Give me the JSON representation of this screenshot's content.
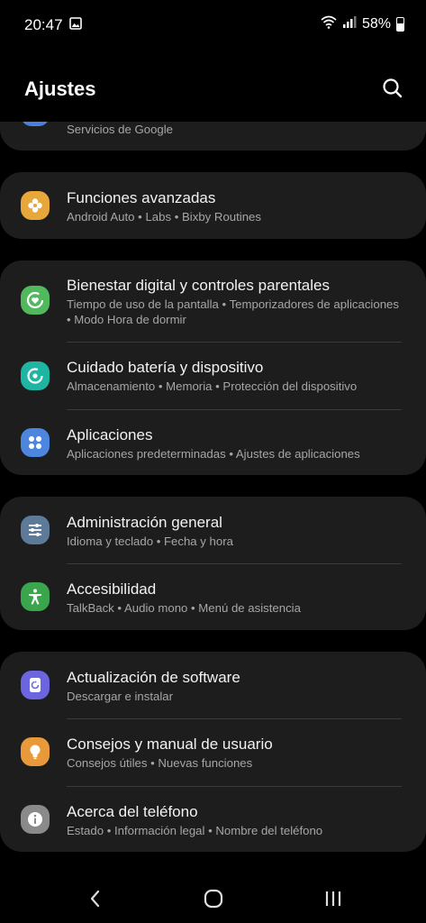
{
  "status": {
    "time": "20:47",
    "battery": "58%"
  },
  "header": {
    "title": "Ajustes"
  },
  "groups": [
    {
      "items": [
        {
          "title": "",
          "subtitle": "Servicios de Google",
          "icon": "google-icon",
          "color": "#4a7fe0"
        }
      ]
    },
    {
      "items": [
        {
          "title": "Funciones avanzadas",
          "subtitle": "Android Auto  •  Labs  •  Bixby Routines",
          "icon": "puzzle-icon",
          "color": "#e7a73a"
        }
      ]
    },
    {
      "items": [
        {
          "title": "Bienestar digital y controles parentales",
          "subtitle": "Tiempo de uso de la pantalla  •  Temporizadores de aplicaciones  •  Modo Hora de dormir",
          "icon": "wellbeing-icon",
          "color": "#52b85e"
        },
        {
          "title": "Cuidado batería y dispositivo",
          "subtitle": "Almacenamiento  •  Memoria  •  Protección del dispositivo",
          "icon": "device-care-icon",
          "color": "#1fb5a3"
        },
        {
          "title": "Aplicaciones",
          "subtitle": "Aplicaciones predeterminadas  •  Ajustes de aplicaciones",
          "icon": "apps-icon",
          "color": "#4d86de"
        }
      ]
    },
    {
      "items": [
        {
          "title": "Administración general",
          "subtitle": "Idioma y teclado  •  Fecha y hora",
          "icon": "sliders-icon",
          "color": "#5d7a99"
        },
        {
          "title": "Accesibilidad",
          "subtitle": "TalkBack  •  Audio mono  •  Menú de asistencia",
          "icon": "accessibility-icon",
          "color": "#3aa54c"
        }
      ]
    },
    {
      "items": [
        {
          "title": "Actualización de software",
          "subtitle": "Descargar e instalar",
          "icon": "update-icon",
          "color": "#6b66e0"
        },
        {
          "title": "Consejos y manual de usuario",
          "subtitle": "Consejos útiles  •  Nuevas funciones",
          "icon": "lightbulb-icon",
          "color": "#e8993a"
        },
        {
          "title": "Acerca del teléfono",
          "subtitle": "Estado  •  Información legal  •  Nombre del teléfono",
          "icon": "info-icon",
          "color": "#8a8a8a"
        }
      ]
    }
  ]
}
